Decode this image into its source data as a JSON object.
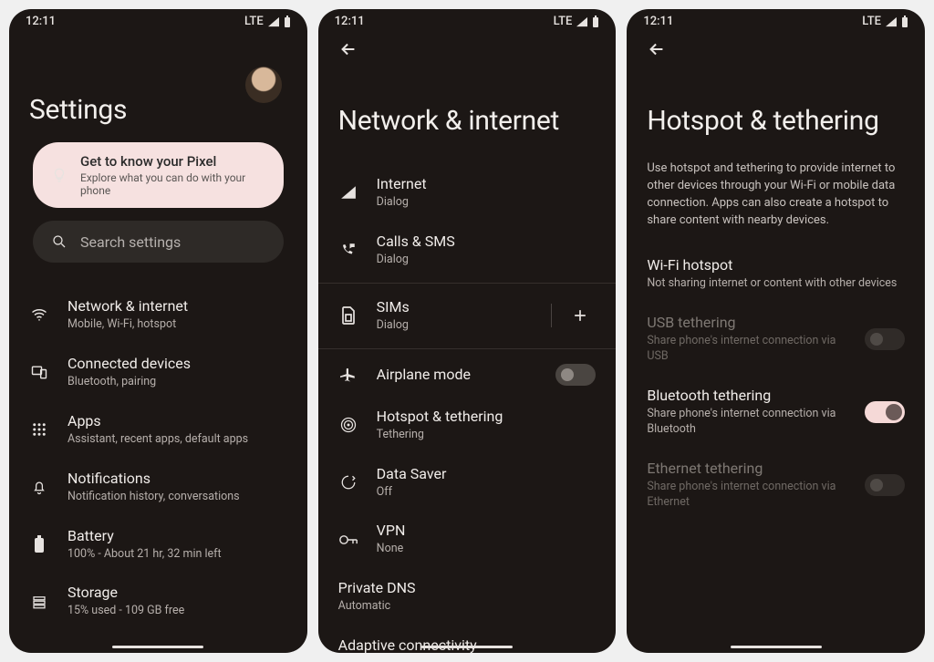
{
  "status": {
    "time": "12:11",
    "net": "LTE"
  },
  "screen1": {
    "title": "Settings",
    "promo": {
      "title": "Get to know your Pixel",
      "sub": "Explore what you can do with your phone"
    },
    "search": {
      "placeholder": "Search settings"
    },
    "items": [
      {
        "title": "Network & internet",
        "sub": "Mobile, Wi-Fi, hotspot"
      },
      {
        "title": "Connected devices",
        "sub": "Bluetooth, pairing"
      },
      {
        "title": "Apps",
        "sub": "Assistant, recent apps, default apps"
      },
      {
        "title": "Notifications",
        "sub": "Notification history, conversations"
      },
      {
        "title": "Battery",
        "sub": "100% - About 21 hr, 32 min left"
      },
      {
        "title": "Storage",
        "sub": "15% used - 109 GB free"
      }
    ]
  },
  "screen2": {
    "title": "Network & internet",
    "items": [
      {
        "title": "Internet",
        "sub": "Dialog"
      },
      {
        "title": "Calls & SMS",
        "sub": "Dialog"
      },
      {
        "title": "SIMs",
        "sub": "Dialog"
      },
      {
        "title": "Airplane mode",
        "sub": ""
      },
      {
        "title": "Hotspot & tethering",
        "sub": "Tethering"
      },
      {
        "title": "Data Saver",
        "sub": "Off"
      },
      {
        "title": "VPN",
        "sub": "None"
      },
      {
        "title": "Private DNS",
        "sub": "Automatic"
      },
      {
        "title": "Adaptive connectivity",
        "sub": ""
      }
    ]
  },
  "screen3": {
    "title": "Hotspot & tethering",
    "desc": "Use hotspot and tethering to provide internet to other devices through your Wi-Fi or mobile data connection. Apps can also create a hotspot to share content with nearby devices.",
    "items": [
      {
        "title": "Wi-Fi hotspot",
        "sub": "Not sharing internet or content with other devices",
        "toggle": null,
        "disabled": false
      },
      {
        "title": "USB tethering",
        "sub": "Share phone's internet connection via USB",
        "toggle": false,
        "disabled": true
      },
      {
        "title": "Bluetooth tethering",
        "sub": "Share phone's internet connection via Bluetooth",
        "toggle": true,
        "disabled": false
      },
      {
        "title": "Ethernet tethering",
        "sub": "Share phone's internet connection via Ethernet",
        "toggle": false,
        "disabled": true
      }
    ]
  }
}
